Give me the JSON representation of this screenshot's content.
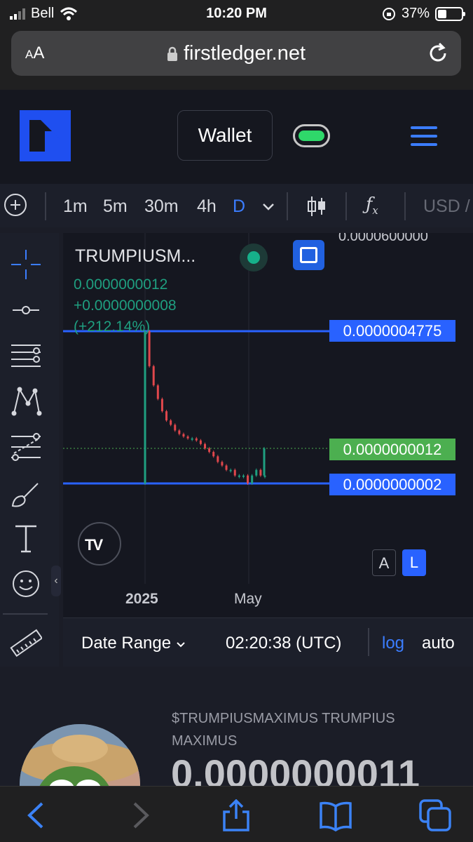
{
  "status_bar": {
    "carrier": "Bell",
    "time": "10:20 PM",
    "battery": "37%",
    "battery_level": 0.37
  },
  "address_bar": {
    "text_size": "AA",
    "url": "firstledger.net"
  },
  "site_header": {
    "wallet_label": "Wallet"
  },
  "chart_toolbar": {
    "intervals": [
      "1m",
      "5m",
      "30m",
      "4h",
      "D"
    ],
    "active_interval": "D",
    "currency": "USD /"
  },
  "chart": {
    "symbol": "TRUMPIUSM...",
    "last_price": "0.0000000012",
    "change": "+0.0000000008",
    "change_pct": "(+212.14%)",
    "top_tick": "0.0000600000",
    "high_tag": "0.0000004775",
    "last_tag": "0.0000000012",
    "low_tag": "0.0000000002",
    "x_labels": [
      "2025",
      "May"
    ],
    "scale_buttons": [
      "A",
      "L"
    ],
    "tv_logo": "TV"
  },
  "chart_footer": {
    "date_range": "Date Range",
    "clock": "02:20:38 (UTC)",
    "log": "log",
    "auto": "auto"
  },
  "token": {
    "name": "$TRUMPIUSMAXIMUS TRUMPIUS MAXIMUS",
    "price": "0.0000000011"
  },
  "colors": {
    "accent": "#2962ff",
    "up": "#1f9f80",
    "down": "#e0474c",
    "last_price": "#4caf50",
    "background": "#151720"
  },
  "chart_data": {
    "type": "candlestick",
    "x_labels": [
      "2025",
      "May"
    ],
    "series": [
      {
        "values": [
          4.775e-07,
          8e-08,
          3e-08,
          1.5e-08,
          8e-09,
          5e-09,
          4e-09,
          3e-09,
          2.5e-09,
          2.2e-09,
          2e-09,
          2e-09,
          1.8e-09,
          1.5e-09,
          1.2e-09,
          1e-09,
          8e-10,
          6e-10,
          5e-10,
          4e-10,
          4e-10,
          3e-10,
          3e-10,
          3e-10,
          2e-10,
          3e-10,
          4e-10,
          3e-10,
          3e-10,
          1.2e-09
        ]
      }
    ],
    "scale": "log",
    "price_lines": [
      4.775e-07,
      1.2e-09,
      2e-10
    ]
  }
}
